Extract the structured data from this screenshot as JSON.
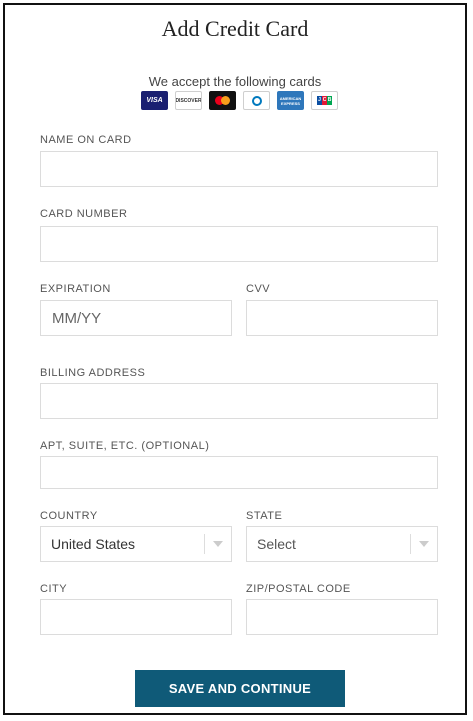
{
  "title": "Add Credit Card",
  "accept_text": "We accept the following cards",
  "cards": [
    {
      "name": "visa-icon",
      "label": "VISA"
    },
    {
      "name": "discover-icon",
      "label": "DISCOVER"
    },
    {
      "name": "mastercard-icon",
      "label": ""
    },
    {
      "name": "diners-club-icon",
      "label": ""
    },
    {
      "name": "amex-icon",
      "label": "AMERICAN EXPRESS"
    },
    {
      "name": "jcb-icon",
      "label": "JCB"
    }
  ],
  "fields": {
    "name_on_card": {
      "label": "NAME ON CARD",
      "value": ""
    },
    "card_number": {
      "label": "CARD NUMBER",
      "value": ""
    },
    "expiration": {
      "label": "EXPIRATION",
      "placeholder": "MM/YY",
      "value": ""
    },
    "cvv": {
      "label": "CVV",
      "value": ""
    },
    "billing_address": {
      "label": "BILLING ADDRESS",
      "value": ""
    },
    "apt": {
      "label": "APT, SUITE, ETC. (OPTIONAL)",
      "value": ""
    },
    "country": {
      "label": "COUNTRY",
      "selected": "United States"
    },
    "state": {
      "label": "STATE",
      "selected": "Select"
    },
    "city": {
      "label": "CITY",
      "value": ""
    },
    "zip": {
      "label": "ZIP/POSTAL CODE",
      "value": ""
    }
  },
  "submit_label": "SAVE AND CONTINUE",
  "colors": {
    "button": "#0f5a78",
    "border": "#dcdcdc"
  }
}
